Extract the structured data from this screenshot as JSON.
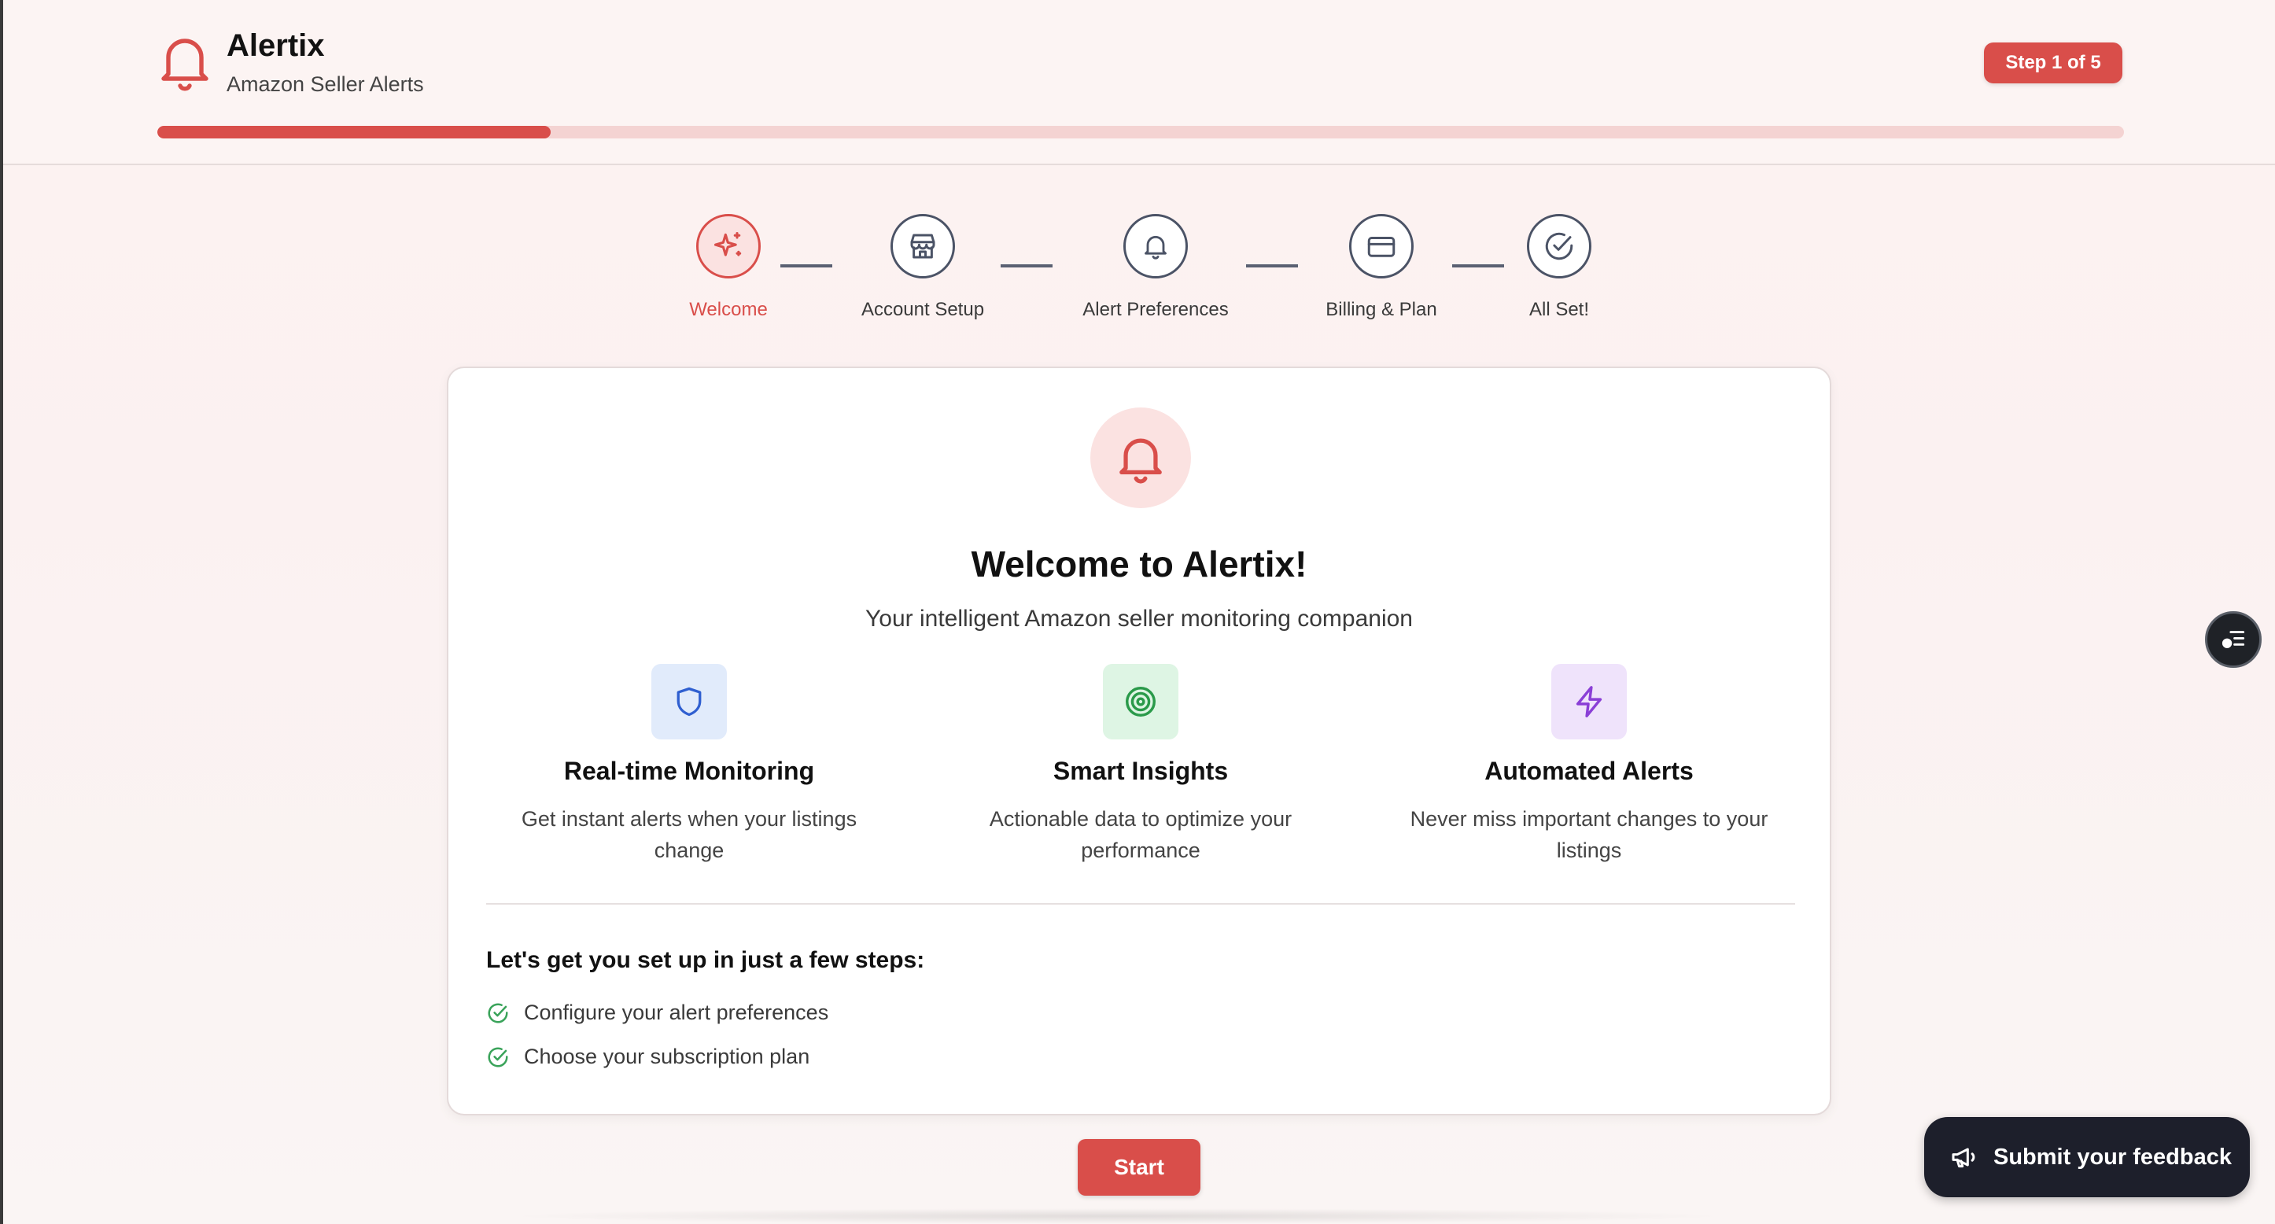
{
  "header": {
    "title": "Alertix",
    "subtitle": "Amazon Seller Alerts",
    "step_badge": "Step 1 of 5",
    "progress_fraction": 0.2
  },
  "stepper": {
    "steps": [
      {
        "label": "Welcome",
        "icon": "sparkles-icon",
        "active": true
      },
      {
        "label": "Account Setup",
        "icon": "store-icon",
        "active": false
      },
      {
        "label": "Alert Preferences",
        "icon": "bell-icon",
        "active": false
      },
      {
        "label": "Billing & Plan",
        "icon": "credit-card-icon",
        "active": false
      },
      {
        "label": "All Set!",
        "icon": "check-circle-icon",
        "active": false
      }
    ]
  },
  "card": {
    "hero_icon": "bell-icon",
    "title": "Welcome to Alertix!",
    "subtitle": "Your intelligent Amazon seller monitoring companion",
    "features": [
      {
        "title": "Real-time Monitoring",
        "desc": "Get instant alerts when your listings change",
        "icon": "shield-icon",
        "color": "#2f5fd0",
        "bg": "#e1ebfb"
      },
      {
        "title": "Smart Insights",
        "desc": "Actionable data to optimize your performance",
        "icon": "target-icon",
        "color": "#2a9a4a",
        "bg": "#def5e4"
      },
      {
        "title": "Automated Alerts",
        "desc": "Never miss important changes to your listings",
        "icon": "lightning-icon",
        "color": "#8a3fd6",
        "bg": "#efe3fb"
      }
    ],
    "setup_title": "Let's get you set up in just a few steps:",
    "setup_items": [
      "Configure your alert preferences",
      "Choose your subscription plan"
    ]
  },
  "start_button": "Start",
  "feedback_button": "Submit your feedback",
  "colors": {
    "accent": "#d94e4a",
    "accent_light": "#fbe2e1",
    "check_green": "#3aa35a",
    "dark": "#1d1f2b"
  }
}
